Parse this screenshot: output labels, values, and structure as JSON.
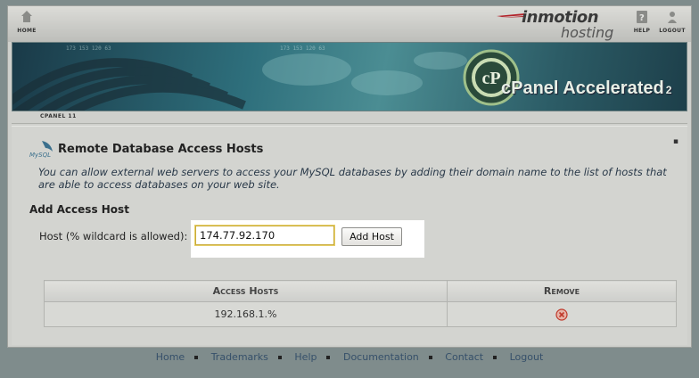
{
  "topbar": {
    "home_label": "HOME",
    "help_label": "HELP",
    "logout_label": "LOGOUT",
    "brand_main": "inmotion",
    "brand_sub": "hosting"
  },
  "banner": {
    "product": "cPanel Accelerated",
    "version_sub": "2"
  },
  "breadcrumb": {
    "label": "CPANEL 11"
  },
  "page": {
    "title": "Remote Database Access Hosts",
    "description": "You can allow external web servers to access your MySQL databases by adding their domain name to the list of hosts that are able to access databases on your web site.",
    "add_heading": "Add Access Host",
    "host_label": "Host (% wildcard is allowed):",
    "host_value": "174.77.92.170",
    "add_button": "Add Host"
  },
  "hosts_table": {
    "columns": [
      "Access Hosts",
      "Remove"
    ],
    "rows": [
      {
        "host": "192.168.1.%"
      }
    ]
  },
  "footer": {
    "links": [
      "Home",
      "Trademarks",
      "Help",
      "Documentation",
      "Contact",
      "Logout"
    ]
  },
  "colors": {
    "highlight": "#ffffff",
    "input_border": "#c9ab3a",
    "link": "#36506a",
    "remove_icon": "#c0392b"
  }
}
